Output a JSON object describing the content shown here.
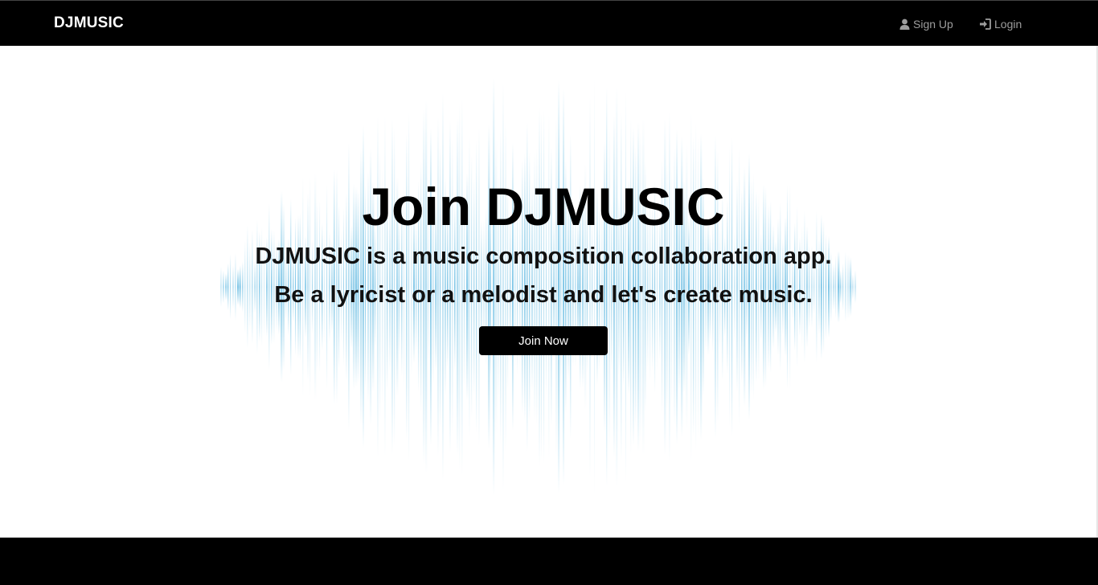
{
  "navbar": {
    "brand": "DJMUSIC",
    "links": [
      {
        "label": "Sign Up",
        "icon": "user-icon"
      },
      {
        "label": "Login",
        "icon": "login-icon"
      }
    ]
  },
  "hero": {
    "title": "Join DJMUSIC",
    "subtitle_line1": "DJMUSIC is a music composition collaboration app.",
    "subtitle_line2": "Be a lyricist or a melodist and let's create music.",
    "cta_label": "Join Now",
    "background_graphic": "sound-wave-graphic"
  },
  "colors": {
    "navbar_bg": "#000000",
    "nav_link": "#9d9d9d",
    "wave": "#7cc6e6",
    "button_bg": "#000000",
    "footer_bg": "#000000"
  }
}
